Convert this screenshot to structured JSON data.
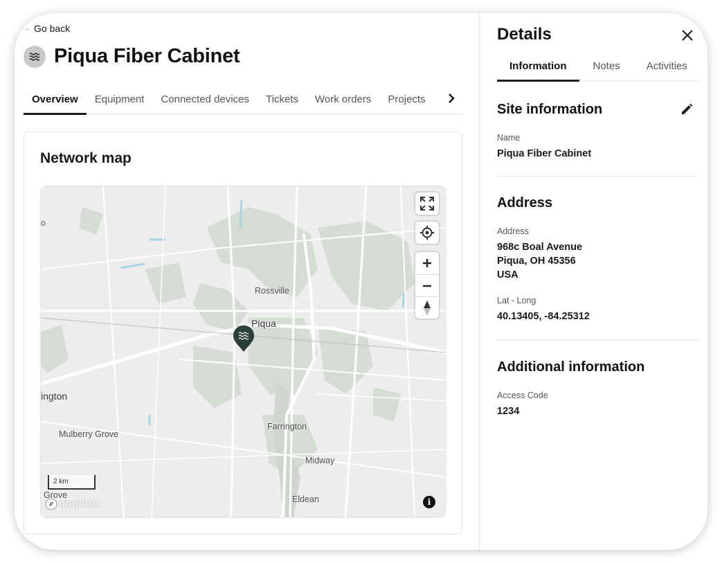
{
  "nav": {
    "back_label": "Go back"
  },
  "site": {
    "title": "Piqua Fiber Cabinet",
    "icon": "water-waves-icon"
  },
  "tabs": [
    {
      "label": "Overview",
      "active": true
    },
    {
      "label": "Equipment",
      "active": false
    },
    {
      "label": "Connected devices",
      "active": false
    },
    {
      "label": "Tickets",
      "active": false
    },
    {
      "label": "Work orders",
      "active": false
    },
    {
      "label": "Projects",
      "active": false
    }
  ],
  "card": {
    "title": "Network map"
  },
  "map": {
    "labels": {
      "rossville": "Rossville",
      "piqua": "Piqua",
      "tington": "ington",
      "mulberry_grove": "Mulberry Grove",
      "farrington": "Farrington",
      "midway": "Midway",
      "grove": "Grove",
      "eldean": "Eldean",
      "o": "o"
    },
    "scale_label": "2 km",
    "attribution": "mapbox",
    "colors": {
      "base": "#ededed",
      "park": "#d4dcd3",
      "water": "#a9d4e4",
      "road": "#ffffff",
      "marker": "#2c3f39"
    }
  },
  "details": {
    "title": "Details",
    "tabs": [
      {
        "label": "Information",
        "active": true
      },
      {
        "label": "Notes",
        "active": false
      },
      {
        "label": "Activities",
        "active": false
      }
    ],
    "site_info": {
      "title": "Site information",
      "name_label": "Name",
      "name_value": "Piqua Fiber Cabinet"
    },
    "address": {
      "title": "Address",
      "address_label": "Address",
      "line1": "968c Boal Avenue",
      "line2": "Piqua, OH 45356",
      "line3": "USA",
      "latlong_label": "Lat - Long",
      "latlong_value": "40.13405, -84.25312"
    },
    "additional": {
      "title": "Additional information",
      "access_label": "Access Code",
      "access_value": "1234"
    }
  }
}
